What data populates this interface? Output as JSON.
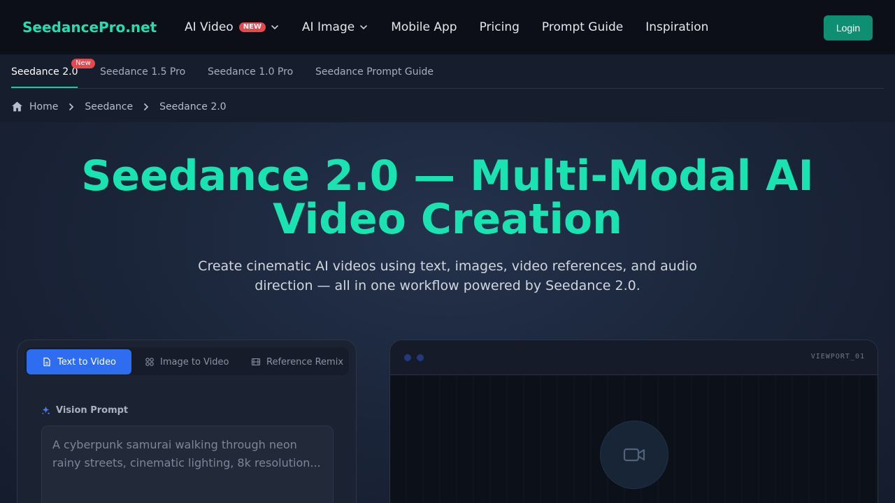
{
  "brand": "SeedancePro.net",
  "nav": {
    "items": [
      {
        "label": "AI Video",
        "badge": "NEW",
        "dropdown": true
      },
      {
        "label": "AI Image",
        "dropdown": true
      },
      {
        "label": "Mobile App"
      },
      {
        "label": "Pricing"
      },
      {
        "label": "Prompt Guide"
      },
      {
        "label": "Inspiration"
      }
    ],
    "login_label": "Login"
  },
  "subnav": {
    "tabs": [
      {
        "label": "Seedance 2.0",
        "badge": "New",
        "active": true
      },
      {
        "label": "Seedance 1.5 Pro"
      },
      {
        "label": "Seedance 1.0 Pro"
      },
      {
        "label": "Seedance Prompt Guide"
      }
    ]
  },
  "breadcrumb": [
    "Home",
    "Seedance",
    "Seedance 2.0"
  ],
  "hero": {
    "title": "Seedance 2.0 — Multi-Modal AI Video Creation",
    "subtitle": "Create cinematic AI videos using text, images, video references, and audio direction — all in one workflow powered by Seedance 2.0."
  },
  "creator": {
    "modes": [
      {
        "label": "Text to Video",
        "icon": "document-icon",
        "active": true
      },
      {
        "label": "Image to Video",
        "icon": "grid-icon"
      },
      {
        "label": "Reference Remix",
        "icon": "film-icon"
      }
    ],
    "prompt_label": "Vision Prompt",
    "prompt_placeholder": "A cyberpunk samurai walking through neon rainy streets, cinematic lighting, 8k resolution..."
  },
  "viewport": {
    "label": "VIEWPORT_01",
    "icon": "video-camera-icon"
  },
  "colors": {
    "accent": "#19e3b1",
    "primary_button": "#2f6df0",
    "login_button": "#0e8f73",
    "badge": "#e5484d"
  }
}
